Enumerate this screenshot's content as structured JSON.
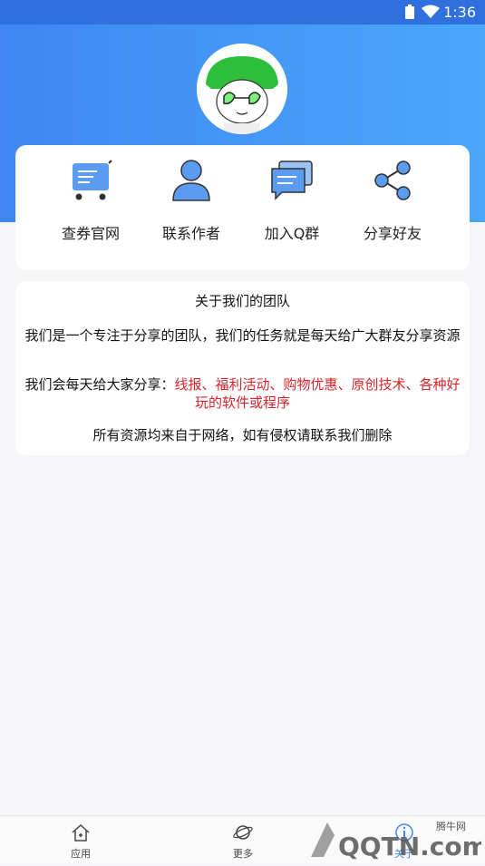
{
  "status_bar": {
    "time": "1:36"
  },
  "menu": [
    {
      "label": "查券官网",
      "icon": "shopping-cart-icon"
    },
    {
      "label": "联系作者",
      "icon": "person-icon"
    },
    {
      "label": "加入Q群",
      "icon": "chat-icon"
    },
    {
      "label": "分享好友",
      "icon": "share-icon"
    }
  ],
  "about": {
    "title": "关于我们的团队",
    "intro": "我们是一个专注于分享的团队，我们的任务就是每天给广大群友分享资源",
    "share_prefix": "我们会每天给大家分享：",
    "share_items": "线报、福利活动、购物优惠、原创技术、各种好玩的软件或程序",
    "disclaimer": "所有资源均来自于网络，如有侵权请联系我们删除"
  },
  "tabs": [
    {
      "label": "应用",
      "icon": "home-icon"
    },
    {
      "label": "更多",
      "icon": "planet-icon"
    },
    {
      "label": "关于",
      "icon": "info-icon"
    }
  ],
  "watermark": {
    "site": "腾牛网",
    "brand": "QQTN.com"
  },
  "colors": {
    "header_start": "#3f86f0",
    "header_end": "#4aa7fa",
    "accent_red": "#d9232a"
  }
}
